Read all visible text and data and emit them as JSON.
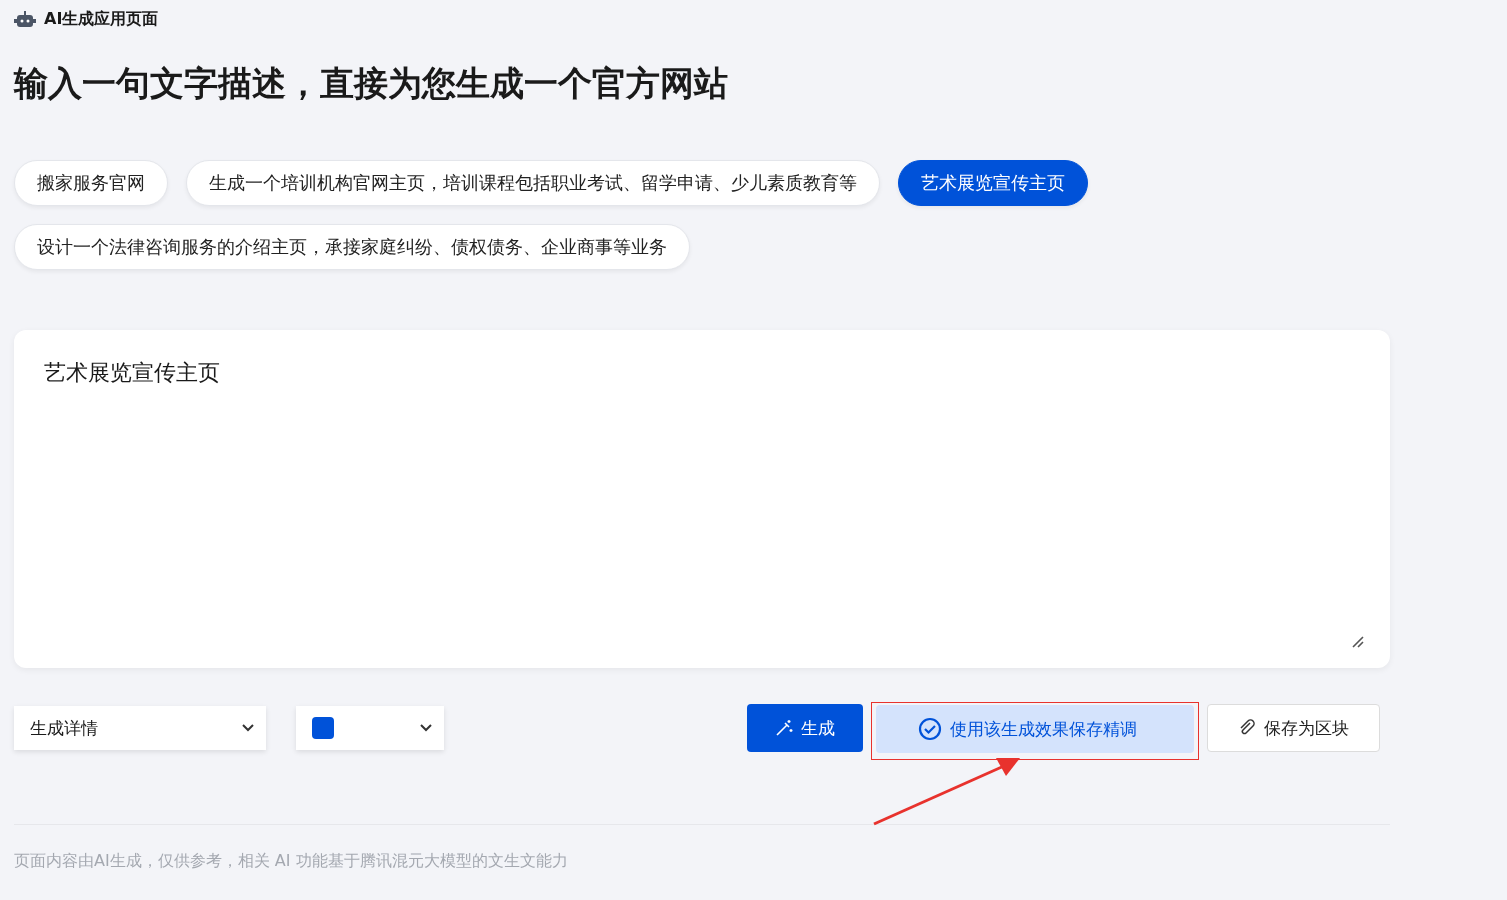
{
  "header": {
    "title": "AI生成应用页面"
  },
  "heading": "输入一句文字描述，直接为您生成一个官方网站",
  "suggestions": [
    {
      "label": "搬家服务官网",
      "selected": false
    },
    {
      "label": "生成一个培训机构官网主页，培训课程包括职业考试、留学申请、少儿素质教育等",
      "selected": false
    },
    {
      "label": "艺术展览宣传主页",
      "selected": true
    },
    {
      "label": "设计一个法律咨询服务的介绍主页，承接家庭纠纷、债权债务、企业商事等业务",
      "selected": false
    }
  ],
  "prompt": {
    "value": "艺术展览宣传主页"
  },
  "controls": {
    "detail_select": {
      "value": "生成详情"
    },
    "color_select": {
      "color": "#0052d9"
    }
  },
  "buttons": [
    {
      "kind": "primary",
      "label": "生成"
    },
    {
      "kind": "light",
      "label": "使用该生成效果保存精调"
    },
    {
      "kind": "outline",
      "label": "保存为区块"
    }
  ],
  "footer": "页面内容由AI生成，仅供参考，相关 AI 功能基于腾讯混元大模型的文生文能力"
}
